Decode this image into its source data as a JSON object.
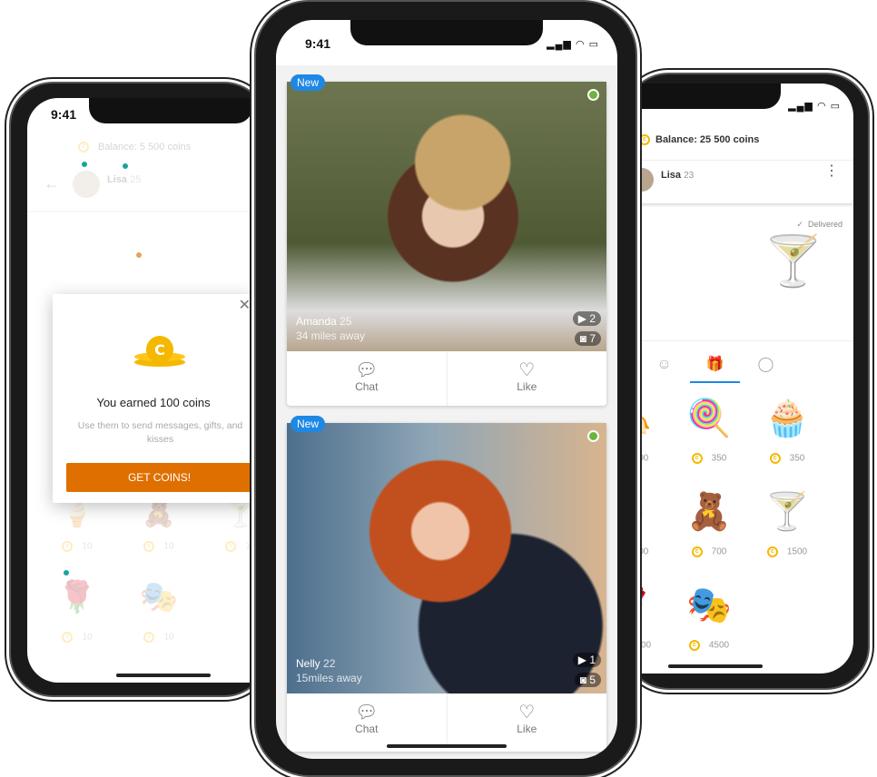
{
  "left_phone": {
    "time": "9:41",
    "balance": "Balance: 5 500 coins",
    "contact": {
      "name": "Lisa",
      "age": "25"
    },
    "modal": {
      "title": "You earned 100 coins",
      "subtitle": "Use them to send messages, gifts, and kisses",
      "button": "GET COINS!"
    },
    "gifts": [
      {
        "price": "10"
      },
      {
        "price": "10"
      },
      {
        "price": "10"
      },
      {
        "price": "10"
      },
      {
        "price": "10"
      }
    ]
  },
  "center_phone": {
    "time": "9:41",
    "profiles": [
      {
        "badge": "New",
        "name": "Amanda",
        "age": "25",
        "distance": "34 miles away",
        "videos": "2",
        "photos": "7",
        "online": true
      },
      {
        "badge": "New",
        "name": "Nelly",
        "age": "22",
        "distance": "15miles away",
        "videos": "1",
        "photos": "5",
        "online": true
      }
    ],
    "actions": {
      "chat": "Chat",
      "like": "Like"
    }
  },
  "right_phone": {
    "balance": "Balance: 25 500 coins",
    "contact": {
      "name": "Lisa",
      "age": "23"
    },
    "delivered": "Delivered",
    "tabs": [
      "sticker",
      "gift",
      "kiss"
    ],
    "active_tab": "gift",
    "gifts": [
      {
        "name": "banana",
        "price": "100"
      },
      {
        "name": "lollipop",
        "price": "350"
      },
      {
        "name": "cupcake",
        "price": "350"
      },
      {
        "name": "ice-cream",
        "price": "700"
      },
      {
        "name": "teddy-bear",
        "price": "700"
      },
      {
        "name": "cocktail",
        "price": "1500"
      },
      {
        "name": "rose",
        "price": "3000"
      },
      {
        "name": "mask",
        "price": "4500"
      }
    ]
  },
  "colors": {
    "accent": "#1e88e5",
    "button": "#df7000",
    "coin": "#f5b800",
    "online": "#6db33f"
  }
}
